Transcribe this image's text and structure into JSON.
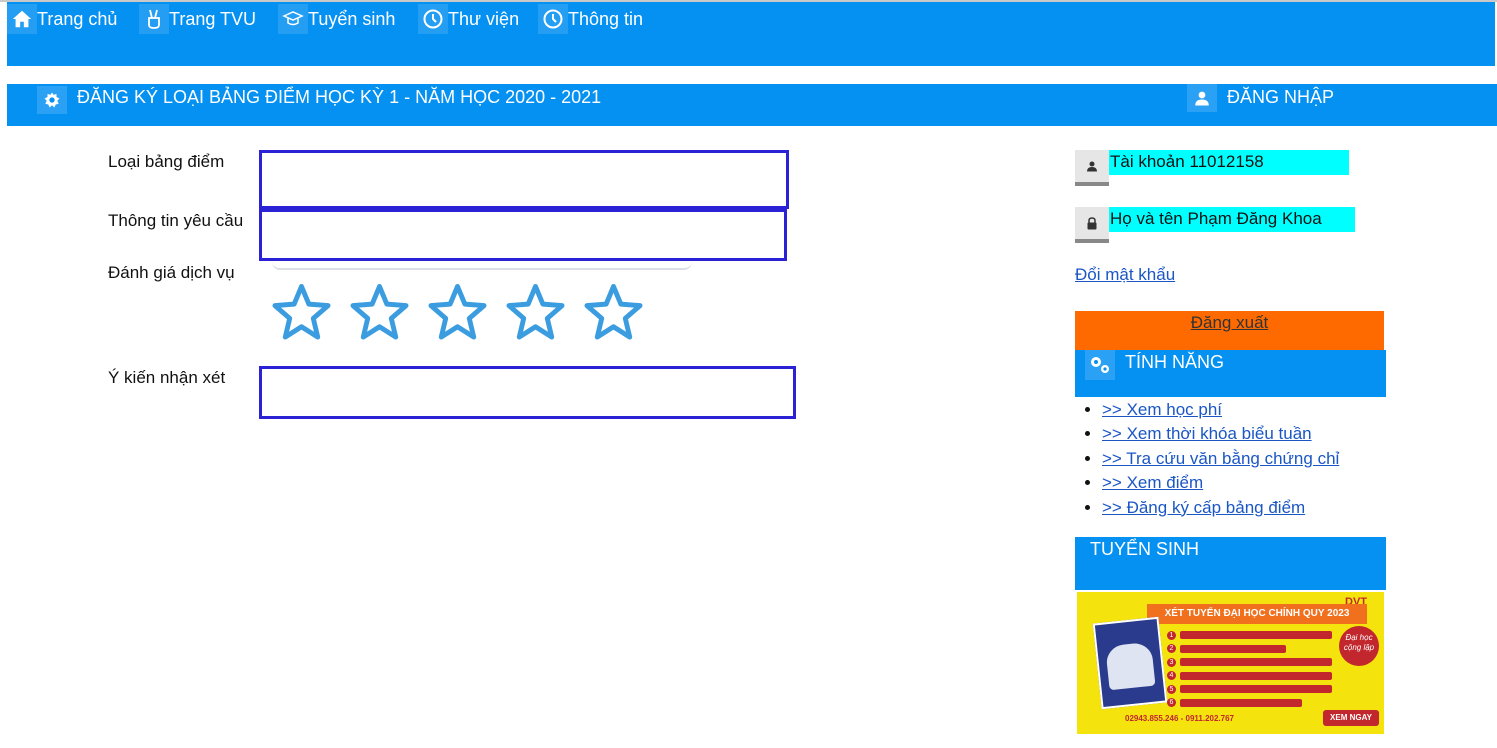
{
  "nav": {
    "items": [
      {
        "label": "Trang chủ",
        "icon": "home-icon"
      },
      {
        "label": "Trang TVU",
        "icon": "peace-hand-icon"
      },
      {
        "label": "Tuyển sinh",
        "icon": "graduation-icon"
      },
      {
        "label": "Thư viện",
        "icon": "clock-icon"
      },
      {
        "label": "Thông tin",
        "icon": "clock-icon"
      }
    ]
  },
  "header": {
    "title": "ĐĂNG KÝ LOẠI BẢNG ĐIỂM HỌC KỲ 1 - NĂM HỌC 2020 - 2021",
    "login_label": "ĐĂNG NHẬP"
  },
  "form": {
    "transcript_type_label": "Loại bảng điểm",
    "transcript_type_value": "",
    "request_info_label": "Thông tin yêu cầu",
    "request_info_value": "",
    "rating_label": "Đánh giá dịch vụ",
    "rating_value": 0,
    "rating_max": 5,
    "comment_label": "Ý kiến nhận xét",
    "comment_value": ""
  },
  "account": {
    "username_text": "Tài khoản 11012158",
    "fullname_text": "Họ và tên Phạm Đăng Khoa",
    "change_password": "Đổi mật khẩu",
    "logout": "Đăng xuất"
  },
  "features": {
    "title": "TÍNH NĂNG",
    "items": [
      ">> Xem học phí",
      ">> Xem thời khóa biểu tuần",
      ">> Tra cứu văn bằng chứng chỉ",
      ">> Xem điểm",
      ">> Đăng ký cấp bảng điểm"
    ]
  },
  "admissions": {
    "title": "TUYỂN SINH",
    "banner": {
      "title": "XÉT TUYỂN ĐẠI HỌC CHÍNH QUY 2023",
      "brand": "DVT",
      "slogan": "Đại học cộng lập",
      "hotline": "02943.855.246 - 0911.202.767",
      "cta": "XEM NGAY"
    }
  },
  "colors": {
    "primary": "#0591f2",
    "field_border": "#2a22d4",
    "account_highlight": "#00ffff",
    "logout_bg": "#ff6a00",
    "link": "#1a56c4",
    "star": "#3b9de0"
  }
}
